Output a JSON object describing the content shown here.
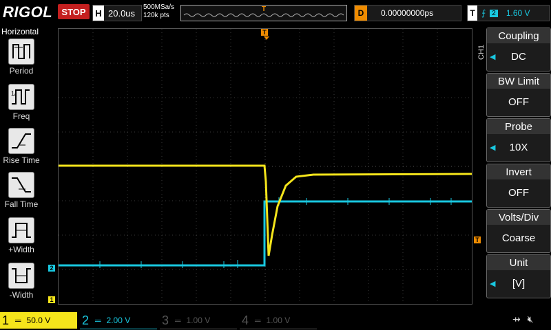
{
  "header": {
    "brand": "RIGOL",
    "run_state": "STOP",
    "horizontal_label": "H",
    "timebase": "20.0us",
    "sample_rate": "500MSa/s",
    "memory_points": "120k pts",
    "trigger_marker": "T",
    "delay_label": "D",
    "delay_value": "0.00000000ps",
    "trigger_label": "T",
    "trigger_edge_icon": "rising-edge-icon",
    "trigger_source": "2",
    "trigger_level": "1.60 V"
  },
  "left_menu": {
    "title": "Horizontal",
    "items": [
      {
        "label": "Period"
      },
      {
        "label": "Freq"
      },
      {
        "label": "Rise Time"
      },
      {
        "label": "Fall Time"
      },
      {
        "label": "+Width"
      },
      {
        "label": "-Width"
      }
    ]
  },
  "right_menu": {
    "channel_tag": "CH1",
    "buttons": [
      {
        "title": "Coupling",
        "value": "DC"
      },
      {
        "title": "BW Limit",
        "value": "OFF"
      },
      {
        "title": "Probe",
        "value": "10X"
      },
      {
        "title": "Invert",
        "value": "OFF"
      },
      {
        "title": "Volts/Div",
        "value": "Coarse"
      },
      {
        "title": "Unit",
        "value": "[V]"
      }
    ]
  },
  "channels": [
    {
      "number": "1",
      "scale": "50.0 V",
      "color": "#f5e51b"
    },
    {
      "number": "2",
      "scale": "2.00 V",
      "color": "#19c8e0"
    },
    {
      "number": "3",
      "scale": "1.00 V",
      "color": "#d020d0"
    },
    {
      "number": "4",
      "scale": "1.00 V",
      "color": "#2a7bd8"
    }
  ],
  "markers": {
    "ch1": "1",
    "ch2": "2",
    "trigger_level": "T"
  },
  "colors": {
    "ch1": "#f5e51b",
    "ch2": "#19c8e0",
    "trigger": "#f08c00",
    "stop": "#c41f1f"
  },
  "status_icons": [
    "usb-icon",
    "speaker-muted-icon"
  ]
}
